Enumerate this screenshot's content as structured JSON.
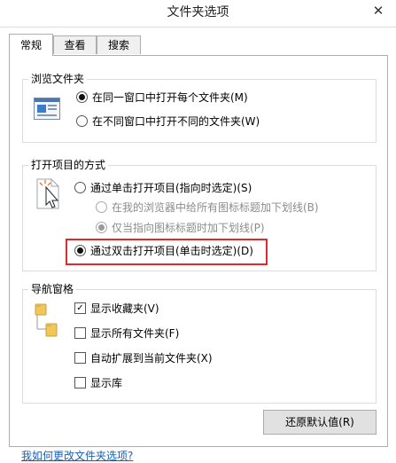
{
  "window": {
    "title": "文件夹选项",
    "close_glyph": "✕"
  },
  "tabs": [
    {
      "label": "常规",
      "active": true
    },
    {
      "label": "查看",
      "active": false
    },
    {
      "label": "搜索",
      "active": false
    }
  ],
  "browse_group": {
    "title": "浏览文件夹",
    "options": [
      {
        "label": "在同一窗口中打开每个文件夹(M)",
        "selected": true
      },
      {
        "label": "在不同窗口中打开不同的文件夹(W)",
        "selected": false
      }
    ]
  },
  "open_group": {
    "title": "打开项目的方式",
    "single_click": {
      "label": "通过单击打开项目(指向时选定)(S)",
      "selected": false
    },
    "underline_browser": {
      "label": "在我的浏览器中给所有图标标题加下划线(B)",
      "selected": false,
      "disabled": true
    },
    "underline_hover": {
      "label": "仅当指向图标标题时加下划线(P)",
      "selected": true,
      "disabled": true
    },
    "double_click": {
      "label": "通过双击打开项目(单击时选定)(D)",
      "selected": true
    }
  },
  "nav_group": {
    "title": "导航窗格",
    "options": [
      {
        "label": "显示收藏夹(V)",
        "checked": true
      },
      {
        "label": "显示所有文件夹(F)",
        "checked": false
      },
      {
        "label": "自动扩展到当前文件夹(X)",
        "checked": false
      },
      {
        "label": "显示库",
        "checked": false
      }
    ]
  },
  "restore_button": "还原默认值(R)",
  "help_link": "我如何更改文件夹选项?",
  "colors": {
    "highlight": "#e02a2a",
    "link": "#1a5fb4"
  }
}
